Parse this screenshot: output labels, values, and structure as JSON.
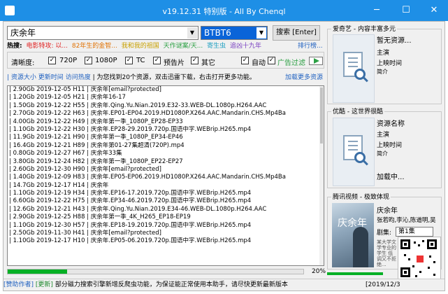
{
  "window": {
    "title": "v19.12.31 特别版 - All By Chenql",
    "min_glyph": "─",
    "max_glyph": "☐",
    "close_glyph": "✕"
  },
  "search": {
    "query": "庆余年",
    "site": "BTBT6",
    "button_label": "搜索 [Enter]",
    "dropdown_glyph": "▼"
  },
  "hot": {
    "label": "热搜:",
    "items": [
      {
        "text": "电影特攻: 以...",
        "color": "#e02020"
      },
      {
        "text": "82年生的金智...",
        "color": "#e07000"
      },
      {
        "text": "我和我的祖国",
        "color": "#c8a000"
      },
      {
        "text": "天作谜案/天...",
        "color": "#2ca044"
      },
      {
        "text": "寄生虫",
        "color": "#20a0c0"
      },
      {
        "text": "追凶十九年",
        "color": "#7a40c0"
      }
    ],
    "more": "排行榜..."
  },
  "options": {
    "label": "清晰度:",
    "q720": "720P",
    "q1080": "1080P",
    "tc": "TC",
    "trailer": "预告片",
    "other": "其它",
    "auto": "自动",
    "adfilter": "广告过滤",
    "check_glyph": "✓"
  },
  "info": {
    "sort_size": "资源大小",
    "sort_time": "更新时间",
    "sort_hot": "访问热度",
    "message": "| 为您找到20个资源，双击迅雷下载，右击打开更多功能。",
    "more_link": "加载更多资源"
  },
  "results": [
    "| 2.90Gb 2019-12-05 H11 | 庆余年[email?protected]",
    "| 1.20Gb 2019-12-05 H21 | 庆余年16-17",
    "| 1.50Gb 2019-12-22 H55 | 庆余年.Qing.Yu.Nian.2019.E32-33.WEB-DL.1080p.H264.AAC",
    "| 2.70Gb 2019-12-22 H63 | 庆余年.EP01-EP04.2019.HD1080P.X264.AAC.Mandarin.CHS.Mp4Ba",
    "| 4.00Gb 2019-12-22 H49 | 庆余年第一季_1080P_EP28-EP33",
    "| 1.10Gb 2019-12-22 H30 | 庆余年.EP28-29.2019.720p.国语中字.WEBrip.H265.mp4",
    "| 11.9Gb 2019-12-21 H90 | 庆余年第一季_1080P_EP34-EP46",
    "| 16.4Gb 2019-12-21 H89 | 庆余年第01-27集超清(720P).mp4",
    "| 0.80Gb 2019-12-27 H67 | 庆余年33集",
    "| 3.80Gb 2019-12-24 H82 | 庆余年第一季_1080P_EP22-EP27",
    "| 2.60Gb 2019-12-30 H90 | 庆余年[email?protected]",
    "| 1.40Gb 2019-12-09 H83 | 庆余年.EP05-EP06.2019.HD1080P.X264.AAC.Mandarin.CHS.Mp4Ba",
    "| 14.7Gb 2019-12-17 H14 | 庆余年",
    "| 1.10Gb 2019-12-19 H34 | 庆余年.EP16-17.2019.720p.国语中字.WEBrip.H265.mp4",
    "| 6.60Gb 2019-12-22 H75 | 庆余年.EP34-46.2019.720p.国语中字.WEBrip.H265.mp4",
    "| 12.6Gb 2019-12-21 H43 | 庆余年.Qing.Yu.Nian.2019.E34-46.WEB-DL.1080p.H264.AAC",
    "| 2.90Gb 2019-12-25 H88 | 庆余年第一季_4K_H265_EP18-EP19",
    "| 1.10Gb 2019-12-30 H57 | 庆余年.EP18-19.2019.720p.国语中字.WEBrip.H265.mp4",
    "| 2.50Gb 2019-11-30 H41 | 庆余年[email?protected]",
    "| 1.10Gb 2019-12-17 H10 | 庆余年.EP05-06.2019.720p.国语中字.WEBrip.H265.mp4"
  ],
  "progress": {
    "percent": 20,
    "text": "20%"
  },
  "iqiyi": {
    "title": "爱奇艺 - 内容丰富多元",
    "status": "暂无资源...",
    "lines": [
      "主演",
      "上映时间",
      "简介"
    ]
  },
  "youku": {
    "title": "优酷 - 这世界很酷",
    "name": "资源名称",
    "lines": [
      "主演",
      "上映时间",
      "简介"
    ],
    "loading": "加载中..."
  },
  "tencent": {
    "title": "腾讯视频 - 极致体现",
    "name": "庆余年",
    "cast": "张若昀,李沁,陈道明,吴",
    "episode_label": "剧集:",
    "episode_value": "第1集",
    "desc": "某大学文学专业的学生 低调又不拒绝...",
    "poster_text": "庆余年"
  },
  "status": {
    "sponsor": "[赞助作者]",
    "update": "[更新]",
    "message": "部分磁力搜索引擎新增反爬虫功能，为保证能正常使用本助手，请尽快更新最新版本",
    "date": "[2019/12/3"
  }
}
